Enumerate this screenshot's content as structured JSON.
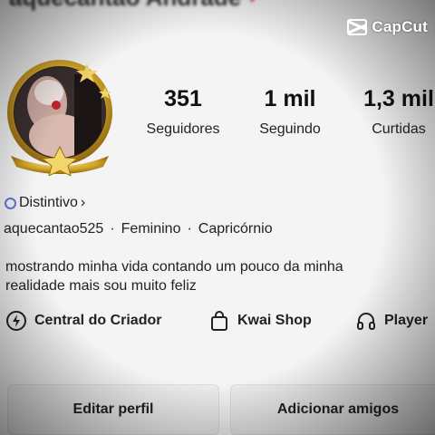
{
  "header": {
    "name_cut": "aquecantao Andrade"
  },
  "watermark": {
    "brand": "CapCut"
  },
  "profile": {
    "stats": [
      {
        "value": "351",
        "label": "Seguidores"
      },
      {
        "value": "1 mil",
        "label": "Seguindo"
      },
      {
        "value": "1,3 mil",
        "label": "Curtidas"
      }
    ],
    "badge_label": "Distintivo",
    "username": "aquecantao525",
    "gender": "Feminino",
    "sign": "Capricórnio",
    "bio_line1": "mostrando minha vida contando um pouco da minha",
    "bio_line2": "realidade mais sou muito feliz"
  },
  "shortcuts": [
    {
      "label": "Central do Criador",
      "icon": "creator-bolt-icon"
    },
    {
      "label": "Kwai Shop",
      "icon": "shopping-bag-icon"
    },
    {
      "label": "Player",
      "icon": "headphones-icon"
    }
  ],
  "actions": {
    "edit_label": "Editar perfil",
    "add_friends_label": "Adicionar amigos"
  },
  "colors": {
    "accent_gold": "#d4a62a",
    "heart": "#e0245e",
    "badge_blue": "#5a7bd6"
  }
}
